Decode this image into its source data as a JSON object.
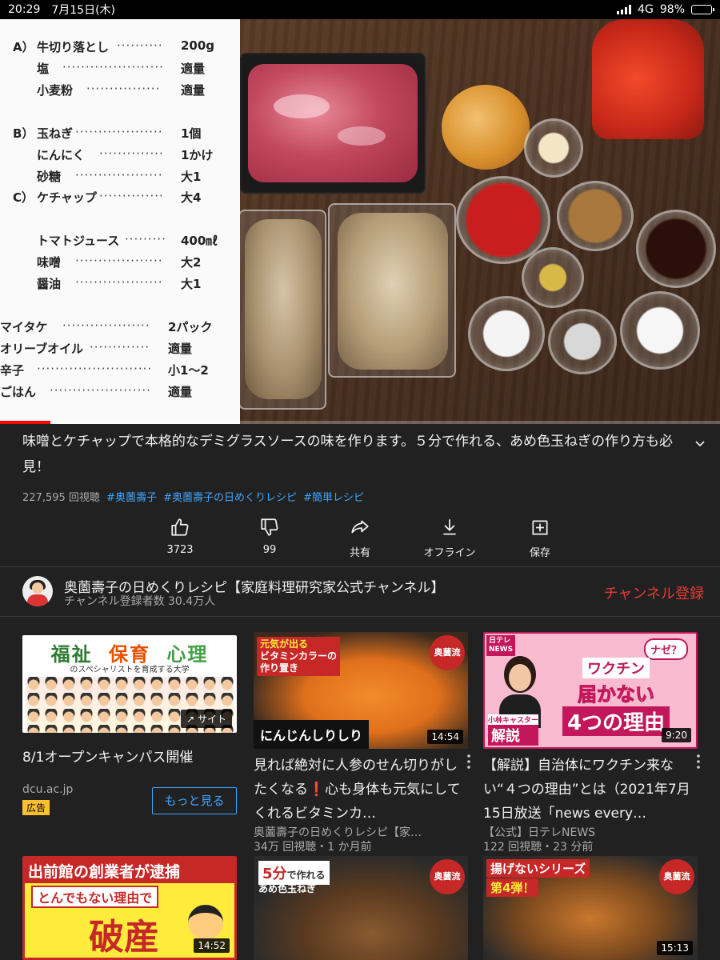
{
  "status": {
    "time": "20:29",
    "date": "7月15日(木)",
    "network": "4G",
    "battery": "98%"
  },
  "video": {
    "progress": 0.07,
    "ingredients": [
      {
        "section": "A）",
        "name": "牛切り落とし",
        "qty": "200g"
      },
      {
        "section": "",
        "name": "塩",
        "qty": "適量"
      },
      {
        "section": "",
        "name": "小麦粉",
        "qty": "適量"
      },
      {
        "section": "B）",
        "name": "玉ねぎ",
        "qty": "1個"
      },
      {
        "section": "",
        "name": "にんにく",
        "qty": "1かけ"
      },
      {
        "section": "",
        "name": "砂糖",
        "qty": "大1"
      },
      {
        "section": "C）",
        "name": "ケチャップ",
        "qty": "大4"
      },
      {
        "section": "",
        "name": "トマトジュース",
        "qty": "400㎖"
      },
      {
        "section": "",
        "name": "味噌",
        "qty": "大2"
      },
      {
        "section": "",
        "name": "醤油",
        "qty": "大1"
      },
      {
        "section": "",
        "name": "マイタケ",
        "qty": "2パック"
      },
      {
        "section": "",
        "name": "オリーブオイル",
        "qty": "適量"
      },
      {
        "section": "",
        "name": "辛子",
        "qty": "小1〜2"
      },
      {
        "section": "",
        "name": "ごはん",
        "qty": "適量"
      }
    ]
  },
  "description": "味噌とケチャップで本格的なデミグラスソースの味を作ります。５分で作れる、あめ色玉ねぎの作り方も必見！",
  "meta": {
    "views": "227,595 回視聴",
    "tags": [
      "#奥薗壽子",
      "#奥薗壽子の日めくりレシピ",
      "#簡単レシピ"
    ]
  },
  "actions": [
    {
      "icon": "thumbs-up-icon",
      "label": "3723"
    },
    {
      "icon": "thumbs-down-icon",
      "label": "99"
    },
    {
      "icon": "share-icon",
      "label": "共有"
    },
    {
      "icon": "download-icon",
      "label": "オフライン"
    },
    {
      "icon": "save-playlist-icon",
      "label": "保存"
    }
  ],
  "channel": {
    "name": "奥薗壽子の日めくりレシピ【家庭料理研究家公式チャンネル】",
    "subscribers": "チャンネル登録者数 30.4万人",
    "subscribe_label": "チャンネル登録"
  },
  "cards": [
    {
      "title": "8/1オープンキャンパス開催",
      "channel": "dcu.ac.jp",
      "ad_label": "広告",
      "more_label": "もっと見る",
      "site_label": "サイト",
      "thumb_text": {
        "w1": "福祉",
        "w2": "保育",
        "w3": "心理",
        "sub": "のスペシャリストを育成する大学"
      }
    },
    {
      "title": "見れば絶対に人参のせん切りがしたくなる❗️心も身体も元気にしてくれるビタミンカ…",
      "channel": "奥薗壽子の日めくりレシピ【家…",
      "stats": "34万 回視聴・1 か月前",
      "duration": "14:54",
      "thumb_text": {
        "top1": "元気が出る",
        "top2": "ビタミンカラーの",
        "top3": "作り置き",
        "badge": "奥薗流",
        "caption": "にんじんしりしり"
      }
    },
    {
      "title": "【解説】自治体にワクチン来ない“４つの理由”とは（2021年7月15日放送「news every…",
      "channel": "【公式】日テレNEWS",
      "stats": "122 回視聴・23 分前",
      "duration": "9:20",
      "thumb_text": {
        "logo1": "日テレ",
        "logo2": "NEWS",
        "q": "ナゼ？",
        "t1": "ワクチン",
        "t2": "届かない",
        "t3": "4つの理由",
        "role": "小林キャスター",
        "kaisetsu": "解説"
      }
    },
    {
      "thumb_text": {
        "headline": "出前館の創業者が逮捕",
        "sub": "とんでもない理由で",
        "big": "破産"
      },
      "duration": "14:52"
    },
    {
      "thumb_text": {
        "top1": "5分",
        "top2": "で作れる",
        "top3": "あめ色玉ねぎ",
        "badge": "奥薗流"
      }
    },
    {
      "thumb_text": {
        "top1": "揚げないシリーズ",
        "top2": "第4弾！",
        "badge": "奥薗流"
      },
      "duration": "15:13"
    }
  ],
  "colors": {
    "subscribe": "#e53935",
    "link": "#3ea6ff",
    "progress": "#ff0000"
  }
}
